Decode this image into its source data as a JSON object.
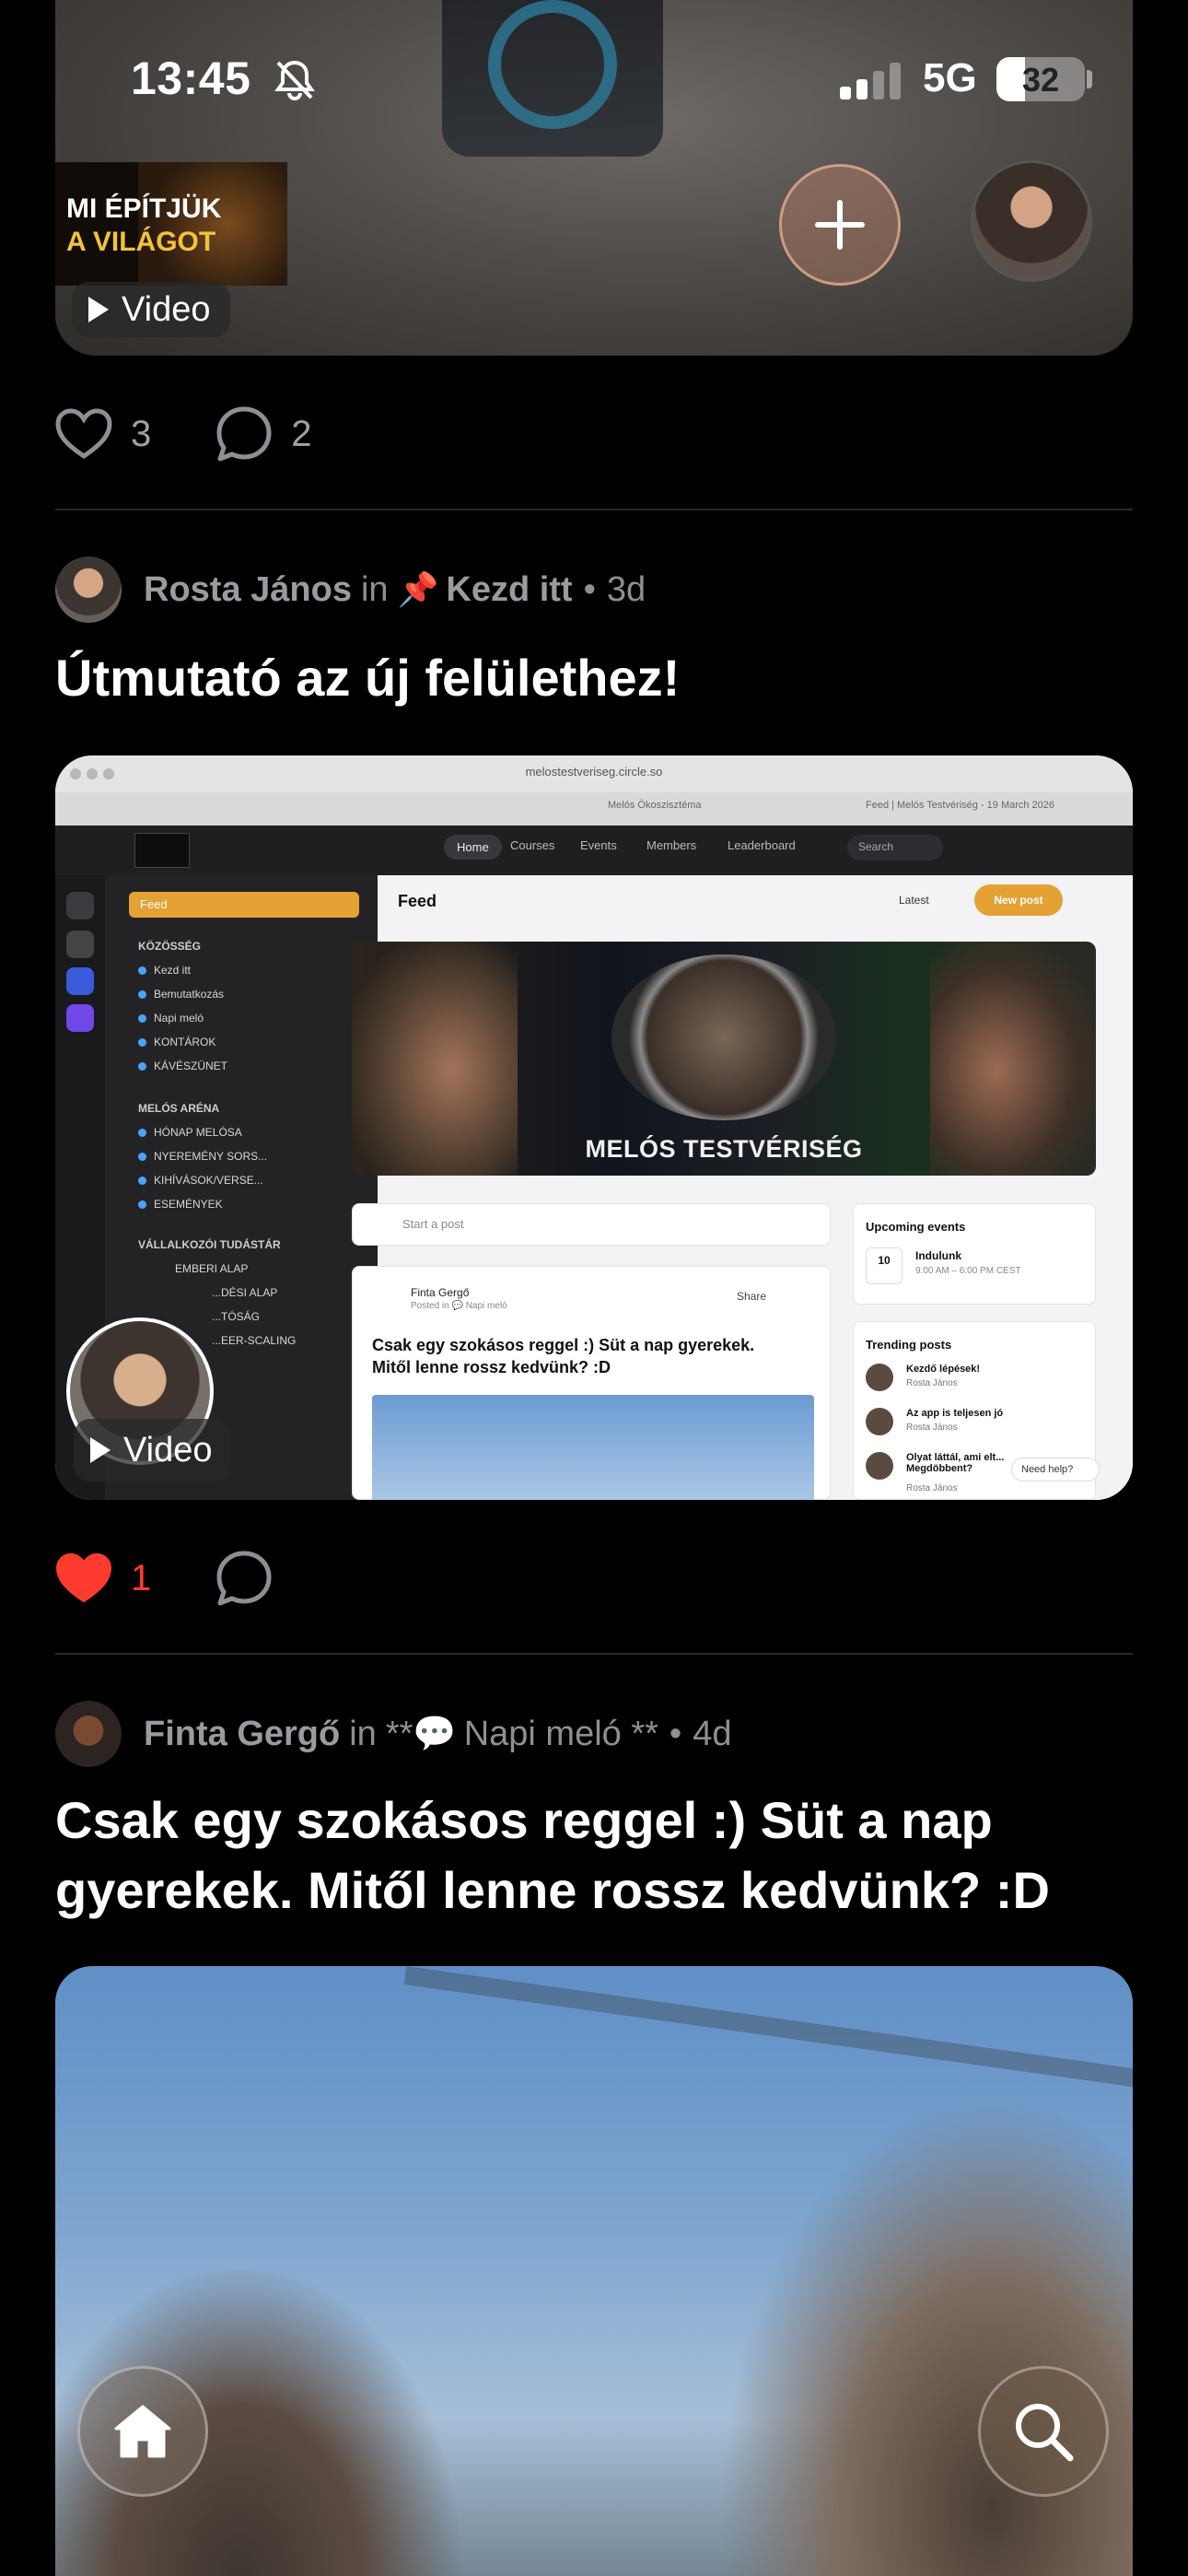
{
  "status_bar": {
    "time": "13:45",
    "network": "5G",
    "battery": "32",
    "battery_fraction": 0.32
  },
  "top_post": {
    "thumbnail": {
      "title_line_1": "MI ÉPÍTJÜK",
      "title_line_2": "A VILÁGOT"
    },
    "video_label": "Video",
    "likes": "3",
    "comments": "2"
  },
  "posts": [
    {
      "author": "Rosta János",
      "in_word": "in",
      "space_emoji": "📌",
      "space": "Kezd itt",
      "age": "3d",
      "title": "Útmutató az új felülethez!",
      "video_label": "Video",
      "likes": "1",
      "liked": true,
      "screenshot": {
        "url": "melostestveriseg.circle.so",
        "tab_1": "Melós Ökoszisztéma",
        "tab_2": "Feed | Melós Testvériség - 19 March 2026",
        "nav": [
          "Home",
          "Courses",
          "Events",
          "Members",
          "Leaderboard"
        ],
        "search": "Search",
        "sidebar_feed": "Feed",
        "sidebar_section_1": "KÖZÖSSÉG",
        "sidebar_items_1": [
          "Kezd itt",
          "Bemutatkozás",
          "Napi meló",
          "KONTÁROK",
          "KÁVÉSZÜNET"
        ],
        "sidebar_section_2": "MELÓS ARÉNA",
        "sidebar_items_2": [
          "HÓNAP MELÓSA",
          "NYEREMÉNY SORS...",
          "KIHÍVÁSOK/VERSE...",
          "ESEMÉNYEK"
        ],
        "sidebar_section_3": "VÁLLALKOZÓI TUDÁSTÁR",
        "sidebar_items_3": [
          "EMBERI ALAP",
          "...DÉSI ALAP",
          "...TÓSÁG",
          "...EER-SCALING"
        ],
        "feed_heading": "Feed",
        "sort": "Latest",
        "new_post": "New post",
        "banner_text": "MELÓS TESTVÉRISÉG",
        "start_post": "Start a post",
        "card_author": "Finta Gergő",
        "card_posted": "Posted in 💬 Napi meló",
        "card_title": "Csak egy szokásos reggel :) Süt a nap gyerekek. Mitől lenne rossz kedvünk? :D",
        "share": "Share",
        "events_title": "Upcoming events",
        "event_day": "10",
        "event_name": "Indulunk",
        "event_time": "9:00 AM – 6:00 PM CEST",
        "trending_title": "Trending posts",
        "trending": [
          {
            "title": "Kezdő lépések!",
            "author": "Rosta János"
          },
          {
            "title": "Az app is teljesen jó",
            "author": "Rosta János"
          },
          {
            "title": "Olyat láttál, ami elt... Megdöbbent?",
            "author": "Rosta János"
          }
        ],
        "need_help": "Need help?"
      }
    },
    {
      "author": "Finta Gergő",
      "in_word": "in",
      "space_prefix": "**💬",
      "space": "Napi meló **",
      "age": "4d",
      "title": "Csak egy szokásos reggel :) Süt a nap gyerekek. Mitől lenne rossz kedvünk? :D"
    }
  ],
  "icons": {
    "like": "heart-icon",
    "comment": "comment-bubble-icon",
    "play": "play-icon",
    "add": "plus-icon",
    "home": "home-icon",
    "search": "search-icon",
    "mute": "bell-slash-icon",
    "signal": "signal-icon"
  },
  "colors": {
    "background": "#000000",
    "liked": "#ff3b30",
    "muted_text": "#8e8e93",
    "accent_orange": "#e4a134"
  }
}
